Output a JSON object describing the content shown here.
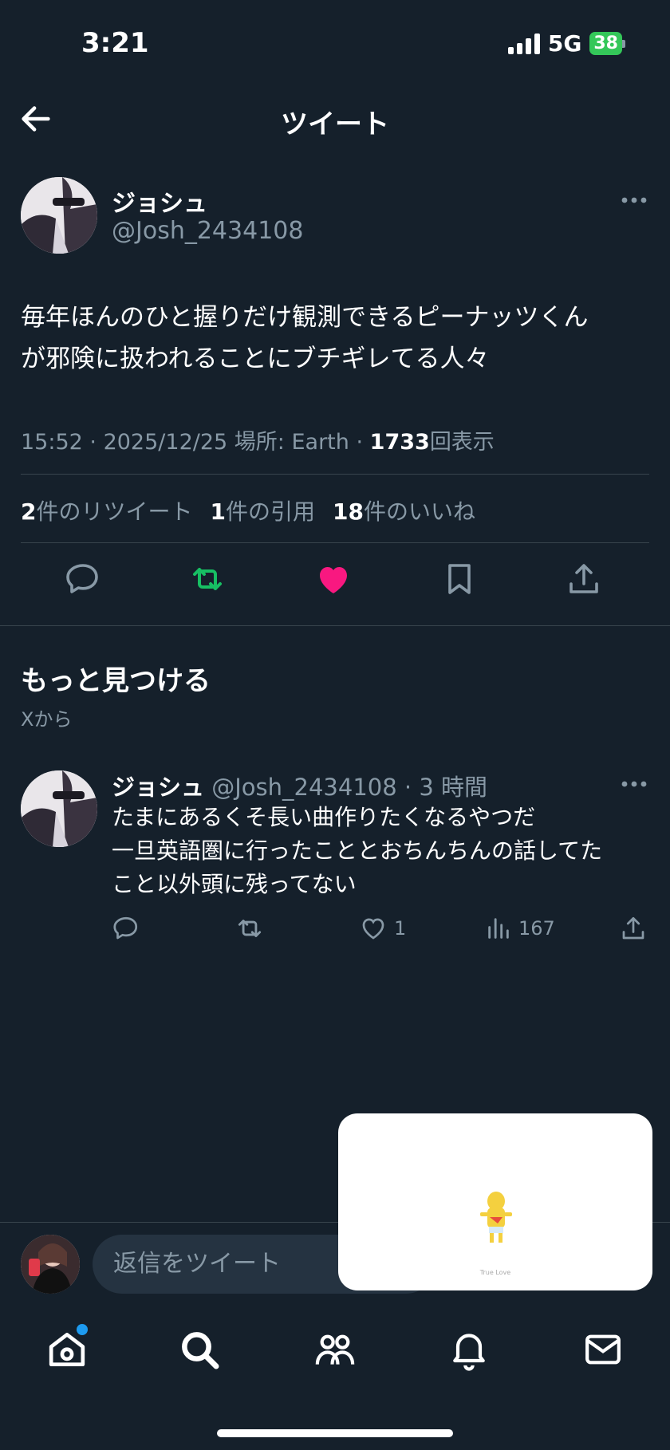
{
  "status_bar": {
    "time": "3:21",
    "network": "5G",
    "battery": "38"
  },
  "header": {
    "title": "ツイート"
  },
  "tweet": {
    "name": "ジョシュ",
    "handle": "@Josh_2434108",
    "text_line1": "毎年ほんのひと握りだけ観測できるピーナッツくん",
    "text_line2": "が邪険に扱われることにブチギレてる人々",
    "time": "15:52",
    "date": "2025/12/25",
    "location_label": "場所: Earth",
    "views_count": "1733",
    "views_label": "回表示",
    "retweets_count": "2",
    "retweets_label": "件のリツイート",
    "quotes_count": "1",
    "quotes_label": "件の引用",
    "likes_count": "18",
    "likes_label": "件のいいね"
  },
  "discover": {
    "title": "もっと見つける",
    "subtitle": "Xから",
    "tweet": {
      "name": "ジョシュ",
      "handle": "@Josh_2434108",
      "time_ago": "3 時間",
      "line1": "たまにあるくそ長い曲作りたくなるやつだ",
      "line2": "一旦英語圏に行ったこととおちんちんの話してた",
      "line3": "こと以外頭に残ってない",
      "likes": "1",
      "views": "167"
    }
  },
  "reply": {
    "placeholder": "返信をツイート"
  },
  "video_overlay": {
    "caption": "True Love"
  },
  "colors": {
    "background": "#15202b",
    "retweet": "#17bf63",
    "like": "#f91880",
    "muted": "#8899a6",
    "accent": "#1d9bf0"
  },
  "icons": [
    "back-icon",
    "more-icon",
    "reply-icon",
    "retweet-icon",
    "like-icon",
    "bookmark-icon",
    "share-icon",
    "views-icon",
    "home-icon",
    "search-icon",
    "communities-icon",
    "notifications-icon",
    "messages-icon"
  ]
}
